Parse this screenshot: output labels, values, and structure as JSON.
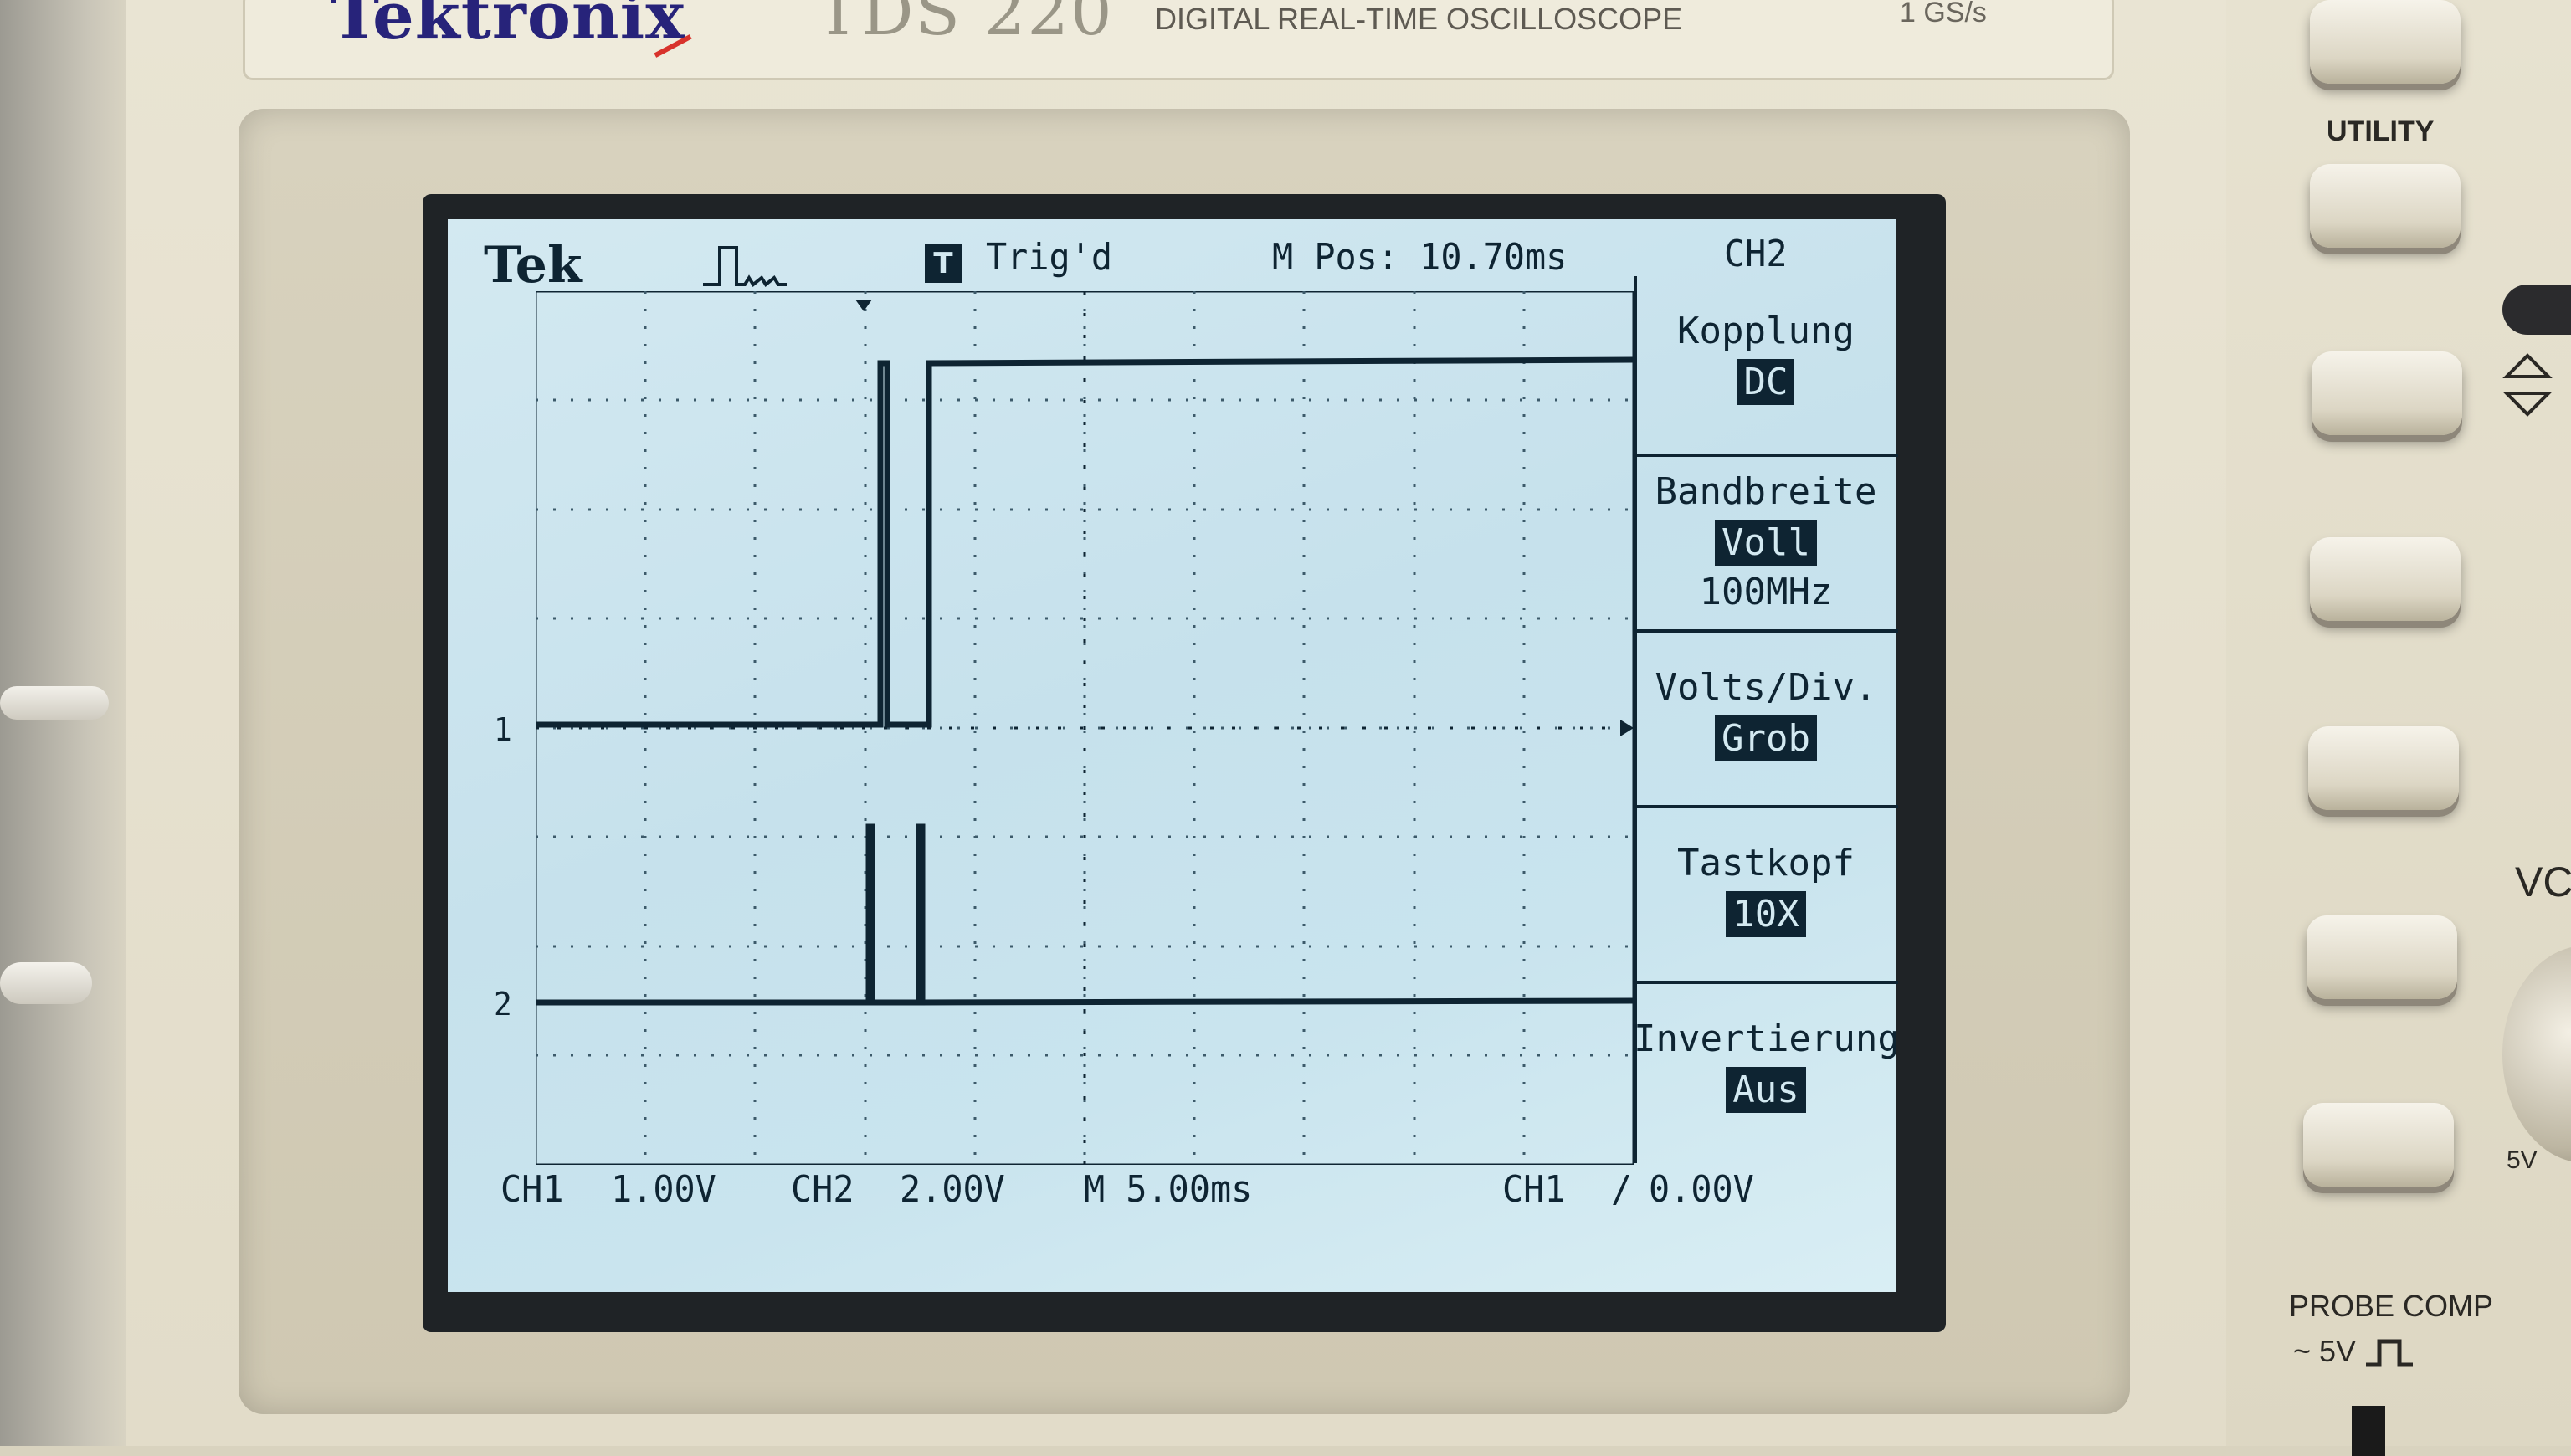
{
  "device": {
    "brand": "Tektronix",
    "model": "TDS 220",
    "subtitle": "DIGITAL REAL-TIME OSCILLOSCOPE",
    "sample_rate": "1 GS/s"
  },
  "screen": {
    "logo": "Tek",
    "trigger_badge": "T",
    "trigger_status": "Trig'd",
    "position": "M Pos: 10.70ms",
    "channel_header": "CH2",
    "ch1_marker": "1",
    "ch2_marker": "2",
    "status": {
      "ch1_label": "CH1",
      "ch1_scale": "1.00V",
      "ch2_label": "CH2",
      "ch2_scale": "2.00V",
      "timebase": "M 5.00ms",
      "trigger_source": "CH1",
      "trigger_slope": "/",
      "trigger_level": "0.00V"
    },
    "menu": [
      {
        "label": "Kopplung",
        "value": "DC",
        "extra": ""
      },
      {
        "label": "Bandbreite",
        "value": "Voll",
        "extra": "100MHz"
      },
      {
        "label": "Volts/Div.",
        "value": "Grob",
        "extra": ""
      },
      {
        "label": "Tastkopf",
        "value": "10X",
        "extra": ""
      },
      {
        "label": "Invertierung",
        "value": "Aus",
        "extra": ""
      }
    ]
  },
  "panel": {
    "utility_label": "UTILITY",
    "probe_comp_label": "PROBE COMP",
    "probe_comp_sub": "~ 5V",
    "vol_label": "VC",
    "knob_label": "5V"
  },
  "colors": {
    "screen_bg": "#c6e1ec",
    "trace": "#0e2432",
    "brand": "#27237a"
  }
}
